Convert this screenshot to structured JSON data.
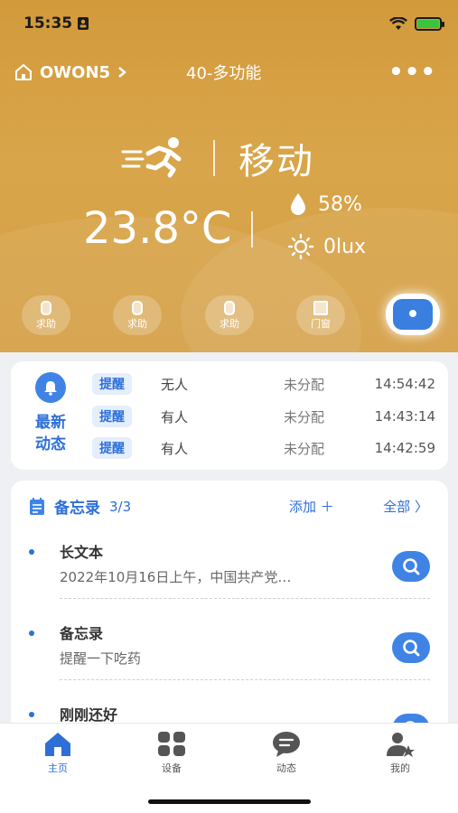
{
  "status_bar": {
    "time": "15:35"
  },
  "nav": {
    "home_name": "OWON5",
    "title": "40-多功能",
    "more": "•••"
  },
  "sensor": {
    "motion_label": "移动",
    "temperature": "23.8°C",
    "humidity": "58%",
    "illuminance": "0lux"
  },
  "device_buttons": [
    {
      "label": "求助"
    },
    {
      "label": "求助"
    },
    {
      "label": "求助"
    },
    {
      "label": "门窗"
    }
  ],
  "latest_events": {
    "title_line1": "最新",
    "title_line2": "动态",
    "rows": [
      {
        "tag": "提醒",
        "status": "无人",
        "group": "未分配",
        "time": "14:54:42"
      },
      {
        "tag": "提醒",
        "status": "有人",
        "group": "未分配",
        "time": "14:43:14"
      },
      {
        "tag": "提醒",
        "status": "有人",
        "group": "未分配",
        "time": "14:42:59"
      }
    ]
  },
  "memo": {
    "title": "备忘录",
    "count": "3/3",
    "add_label": "添加 ＋",
    "all_label": "全部 〉",
    "items": [
      {
        "title": "长文本",
        "subtitle": "2022年10月16日上午，中国共产党…"
      },
      {
        "title": "备忘录",
        "subtitle": "提醒一下吃药"
      },
      {
        "title": "刚刚还好",
        "subtitle": ""
      }
    ]
  },
  "tabbar": [
    {
      "label": "主页",
      "icon": "home-icon"
    },
    {
      "label": "设备",
      "icon": "grid-icon"
    },
    {
      "label": "动态",
      "icon": "chat-icon"
    },
    {
      "label": "我的",
      "icon": "user-star-icon"
    }
  ],
  "colors": {
    "hero": "#d29a3b",
    "accent": "#2e6fd6",
    "accent_btn": "#3f84e5"
  }
}
